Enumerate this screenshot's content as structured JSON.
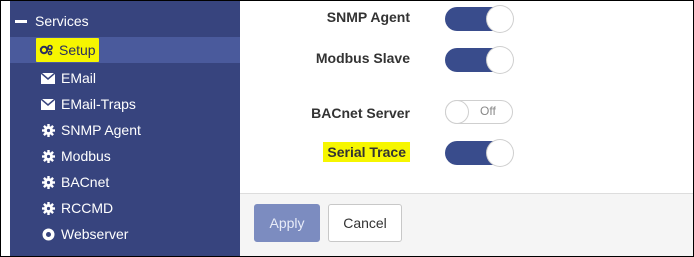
{
  "sidebar": {
    "header": "Services",
    "items": [
      {
        "label": "Setup",
        "icon": "gears-icon",
        "active": true,
        "highlighted": true
      },
      {
        "label": "EMail",
        "icon": "envelope-icon"
      },
      {
        "label": "EMail-Traps",
        "icon": "envelope-icon"
      },
      {
        "label": "SNMP Agent",
        "icon": "gear-icon"
      },
      {
        "label": "Modbus",
        "icon": "gear-icon"
      },
      {
        "label": "BACnet",
        "icon": "gear-icon"
      },
      {
        "label": "RCCMD",
        "icon": "gear-icon"
      },
      {
        "label": "Webserver",
        "icon": "globe-icon"
      }
    ]
  },
  "settings": {
    "snmp_agent": {
      "label": "SNMP Agent",
      "on": true
    },
    "modbus_slave": {
      "label": "Modbus Slave",
      "on": true
    },
    "bacnet_server": {
      "label": "BACnet Server",
      "on": false,
      "off_text": "Off"
    },
    "serial_trace": {
      "label": "Serial Trace",
      "on": true,
      "highlighted": true
    }
  },
  "buttons": {
    "apply": "Apply",
    "cancel": "Cancel"
  },
  "colors": {
    "sidebar_bg": "#37447e",
    "toggle_on": "#394c8c",
    "highlight": "#f6f600"
  }
}
